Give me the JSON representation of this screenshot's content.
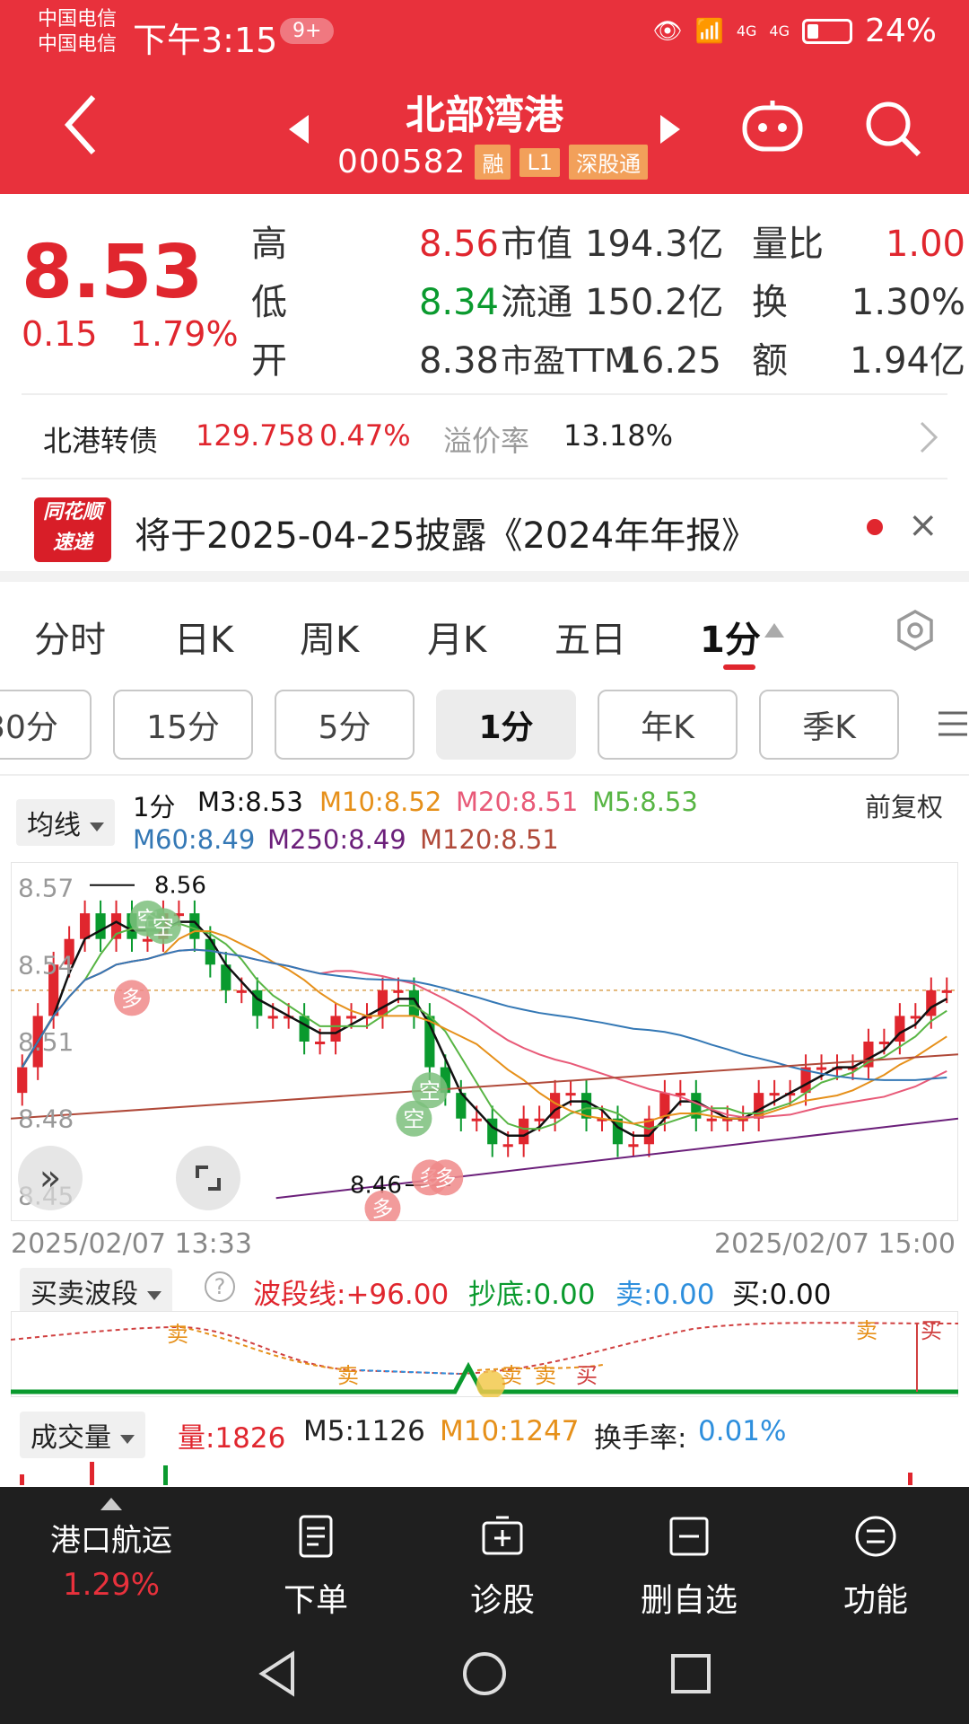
{
  "status_bar": {
    "carrier1": "中国电信",
    "carrier2": "中国电信",
    "time": "下午3:15",
    "badge": "9+",
    "net1": "4G",
    "net2": "4G",
    "battery": "24%"
  },
  "header": {
    "stock_name": "北部湾港",
    "stock_code": "000582",
    "tags": [
      "融",
      "L1",
      "深股通"
    ]
  },
  "quote": {
    "price": "8.53",
    "change": "0.15",
    "change_pct": "1.79%",
    "high_label": "高",
    "high": "8.56",
    "low_label": "低",
    "low": "8.34",
    "open_label": "开",
    "open": "8.38",
    "mcap_label": "市值",
    "mcap": "194.3亿",
    "float_label": "流通",
    "float": "150.2亿",
    "pe_label": "市盈TTM",
    "pe": "16.25",
    "vr_label": "量比",
    "vr": "1.00",
    "turn_label": "换",
    "turn": "1.30%",
    "amt_label": "额",
    "amt": "1.94亿"
  },
  "bond": {
    "name": "北港转债",
    "price": "129.758",
    "pct": "0.47%",
    "premium_label": "溢价率",
    "premium": "13.18%"
  },
  "news": {
    "logo_line1": "同花顺",
    "logo_line2": "速递",
    "text": "将于2025-04-25披露《2024年年报》"
  },
  "period_tabs": [
    "分时",
    "日K",
    "周K",
    "月K",
    "五日",
    "1分"
  ],
  "sub_tabs": [
    "30分",
    "15分",
    "5分",
    "1分",
    "年K",
    "季K"
  ],
  "indicators": {
    "dropdown": "均线",
    "period": "1分",
    "m3": "M3:8.53",
    "m10": "M10:8.52",
    "m20": "M20:8.51",
    "m5": "M5:8.53",
    "m60": "M60:8.49",
    "m250": "M250:8.49",
    "m120": "M120:8.51",
    "adjust": "前复权"
  },
  "chart_data": {
    "type": "candlestick",
    "title": "",
    "y_ticks": [
      8.57,
      8.54,
      8.51,
      8.48,
      8.45
    ],
    "ylim": [
      8.44,
      8.58
    ],
    "annot_high": "8.56",
    "annot_low": "8.46",
    "x_start": "2025/02/07 13:33",
    "x_end": "2025/02/07 15:00",
    "close": [
      8.5,
      8.52,
      8.54,
      8.55,
      8.56,
      8.55,
      8.56,
      8.55,
      8.55,
      8.56,
      8.56,
      8.55,
      8.54,
      8.53,
      8.53,
      8.52,
      8.52,
      8.52,
      8.51,
      8.51,
      8.52,
      8.52,
      8.52,
      8.53,
      8.53,
      8.52,
      8.5,
      8.49,
      8.48,
      8.48,
      8.47,
      8.47,
      8.48,
      8.48,
      8.49,
      8.49,
      8.48,
      8.48,
      8.47,
      8.47,
      8.48,
      8.49,
      8.49,
      8.48,
      8.48,
      8.48,
      8.48,
      8.49,
      8.49,
      8.49,
      8.5,
      8.5,
      8.5,
      8.5,
      8.51,
      8.51,
      8.52,
      8.52,
      8.53,
      8.53
    ],
    "ma_colors": {
      "m3": "#111111",
      "m5": "#58b544",
      "m10": "#e6901a",
      "m20": "#e85a78",
      "m60": "#3478b5",
      "m120": "#b04a3a",
      "m250": "#6b1f7a"
    },
    "markers": [
      "空",
      "空",
      "多",
      "空",
      "空",
      "多",
      "多",
      "多"
    ]
  },
  "wave": {
    "dropdown": "买卖波段",
    "line": "波段线:+96.00",
    "bottom": "抄底:0.00",
    "sell": "卖:0.00",
    "buy": "买:0.00",
    "labels": [
      "卖",
      "卖",
      "卖",
      "卖",
      "买",
      "卖",
      "买"
    ]
  },
  "volume": {
    "dropdown": "成交量",
    "vol": "量:1826",
    "m5": "M5:1126",
    "m10": "M10:1247",
    "turnover_label": "换手率:",
    "turnover": "0.01%"
  },
  "bottom_bar": {
    "sector_name": "港口航运",
    "sector_pct": "1.29%",
    "order": "下单",
    "diagnose": "诊股",
    "remove": "删自选",
    "functions": "功能"
  }
}
